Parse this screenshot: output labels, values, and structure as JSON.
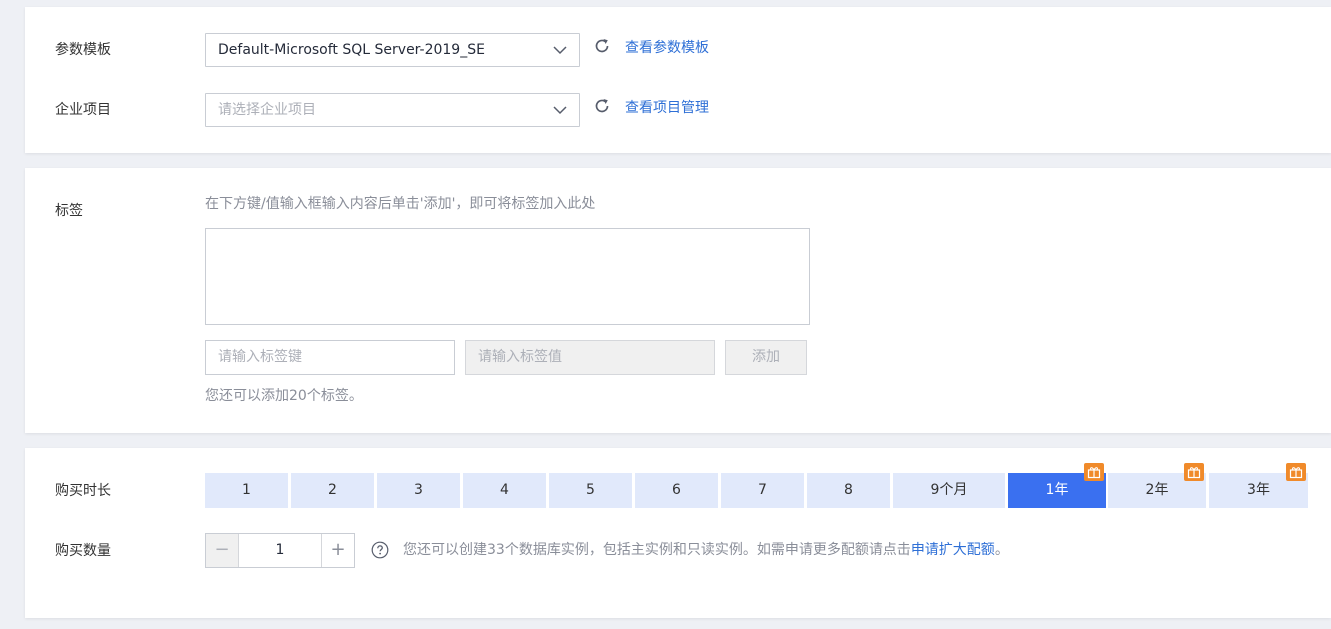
{
  "param_template": {
    "label": "参数模板",
    "value": "Default-Microsoft SQL Server-2019_SE",
    "link": "查看参数模板"
  },
  "enterprise_project": {
    "label": "企业项目",
    "placeholder": "请选择企业项目",
    "link": "查看项目管理"
  },
  "tags": {
    "label": "标签",
    "hint": "在下方键/值输入框输入内容后单击'添加'，即可将标签加入此处",
    "key_placeholder": "请输入标签键",
    "value_placeholder": "请输入标签值",
    "add_button": "添加",
    "remaining": "您还可以添加20个标签。"
  },
  "duration": {
    "label": "购买时长",
    "options": [
      {
        "label": "1"
      },
      {
        "label": "2"
      },
      {
        "label": "3"
      },
      {
        "label": "4"
      },
      {
        "label": "5"
      },
      {
        "label": "6"
      },
      {
        "label": "7"
      },
      {
        "label": "8"
      },
      {
        "label": "9个月"
      },
      {
        "label": "1年",
        "selected": true,
        "icon": "gift-icon"
      },
      {
        "label": "2年",
        "icon": "gift-icon"
      },
      {
        "label": "3年",
        "icon": "gift-icon"
      }
    ],
    "active_color": "#3a70f0",
    "inactive_color": "#e1e9fb",
    "gift_color": "#f08a2a"
  },
  "quantity": {
    "label": "购买数量",
    "value": "1",
    "minus": "−",
    "plus": "+",
    "help_text": "您还可以创建33个数据库实例，包括主实例和只读实例。如需申请更多配额请点击",
    "help_link": "申请扩大配额",
    "help_end": "。"
  }
}
